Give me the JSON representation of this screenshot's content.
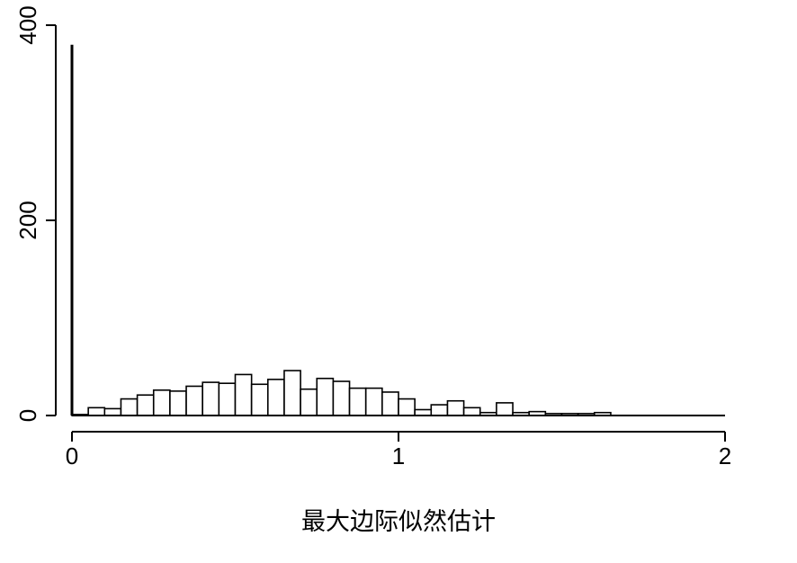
{
  "chart_data": {
    "type": "bar",
    "title": "",
    "xlabel": "最大边际似然估计",
    "ylabel": "",
    "xlim": [
      0,
      2
    ],
    "ylim": [
      0,
      400
    ],
    "x_ticks": [
      0,
      1,
      2
    ],
    "y_ticks": [
      0,
      200,
      400
    ],
    "x_tick_labels": [
      "0",
      "1",
      "2"
    ],
    "y_tick_labels": [
      "0",
      "200",
      "400"
    ],
    "grid": false,
    "spike": {
      "x": 0,
      "value": 380
    },
    "bin_width": 0.05,
    "bins": [
      {
        "x0": 0.0,
        "x1": 0.05,
        "count": 1
      },
      {
        "x0": 0.05,
        "x1": 0.1,
        "count": 8
      },
      {
        "x0": 0.1,
        "x1": 0.15,
        "count": 7
      },
      {
        "x0": 0.15,
        "x1": 0.2,
        "count": 17
      },
      {
        "x0": 0.2,
        "x1": 0.25,
        "count": 21
      },
      {
        "x0": 0.25,
        "x1": 0.3,
        "count": 26
      },
      {
        "x0": 0.3,
        "x1": 0.35,
        "count": 25
      },
      {
        "x0": 0.35,
        "x1": 0.4,
        "count": 30
      },
      {
        "x0": 0.4,
        "x1": 0.45,
        "count": 34
      },
      {
        "x0": 0.45,
        "x1": 0.5,
        "count": 33
      },
      {
        "x0": 0.5,
        "x1": 0.55,
        "count": 42
      },
      {
        "x0": 0.55,
        "x1": 0.6,
        "count": 32
      },
      {
        "x0": 0.6,
        "x1": 0.65,
        "count": 37
      },
      {
        "x0": 0.65,
        "x1": 0.7,
        "count": 46
      },
      {
        "x0": 0.7,
        "x1": 0.75,
        "count": 27
      },
      {
        "x0": 0.75,
        "x1": 0.8,
        "count": 38
      },
      {
        "x0": 0.8,
        "x1": 0.85,
        "count": 35
      },
      {
        "x0": 0.85,
        "x1": 0.9,
        "count": 28
      },
      {
        "x0": 0.9,
        "x1": 0.95,
        "count": 28
      },
      {
        "x0": 0.95,
        "x1": 1.0,
        "count": 24
      },
      {
        "x0": 1.0,
        "x1": 1.05,
        "count": 17
      },
      {
        "x0": 1.05,
        "x1": 1.1,
        "count": 6
      },
      {
        "x0": 1.1,
        "x1": 1.15,
        "count": 11
      },
      {
        "x0": 1.15,
        "x1": 1.2,
        "count": 15
      },
      {
        "x0": 1.2,
        "x1": 1.25,
        "count": 8
      },
      {
        "x0": 1.25,
        "x1": 1.3,
        "count": 3
      },
      {
        "x0": 1.3,
        "x1": 1.35,
        "count": 13
      },
      {
        "x0": 1.35,
        "x1": 1.4,
        "count": 3
      },
      {
        "x0": 1.4,
        "x1": 1.45,
        "count": 4
      },
      {
        "x0": 1.45,
        "x1": 1.5,
        "count": 2
      },
      {
        "x0": 1.5,
        "x1": 1.55,
        "count": 2
      },
      {
        "x0": 1.55,
        "x1": 1.6,
        "count": 2
      },
      {
        "x0": 1.6,
        "x1": 1.65,
        "count": 3
      }
    ]
  }
}
